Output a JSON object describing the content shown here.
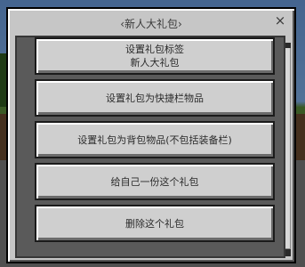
{
  "dialog": {
    "title": "‹新人大礼包›",
    "close_glyph": "×"
  },
  "buttons": [
    {
      "line1": "设置礼包标签",
      "line2": "新人大礼包"
    },
    {
      "line1": "设置礼包为快捷栏物品"
    },
    {
      "line1": "设置礼包为背包物品(不包括装备栏)"
    },
    {
      "line1": "给自己一份这个礼包"
    },
    {
      "line1": "删除这个礼包"
    }
  ]
}
